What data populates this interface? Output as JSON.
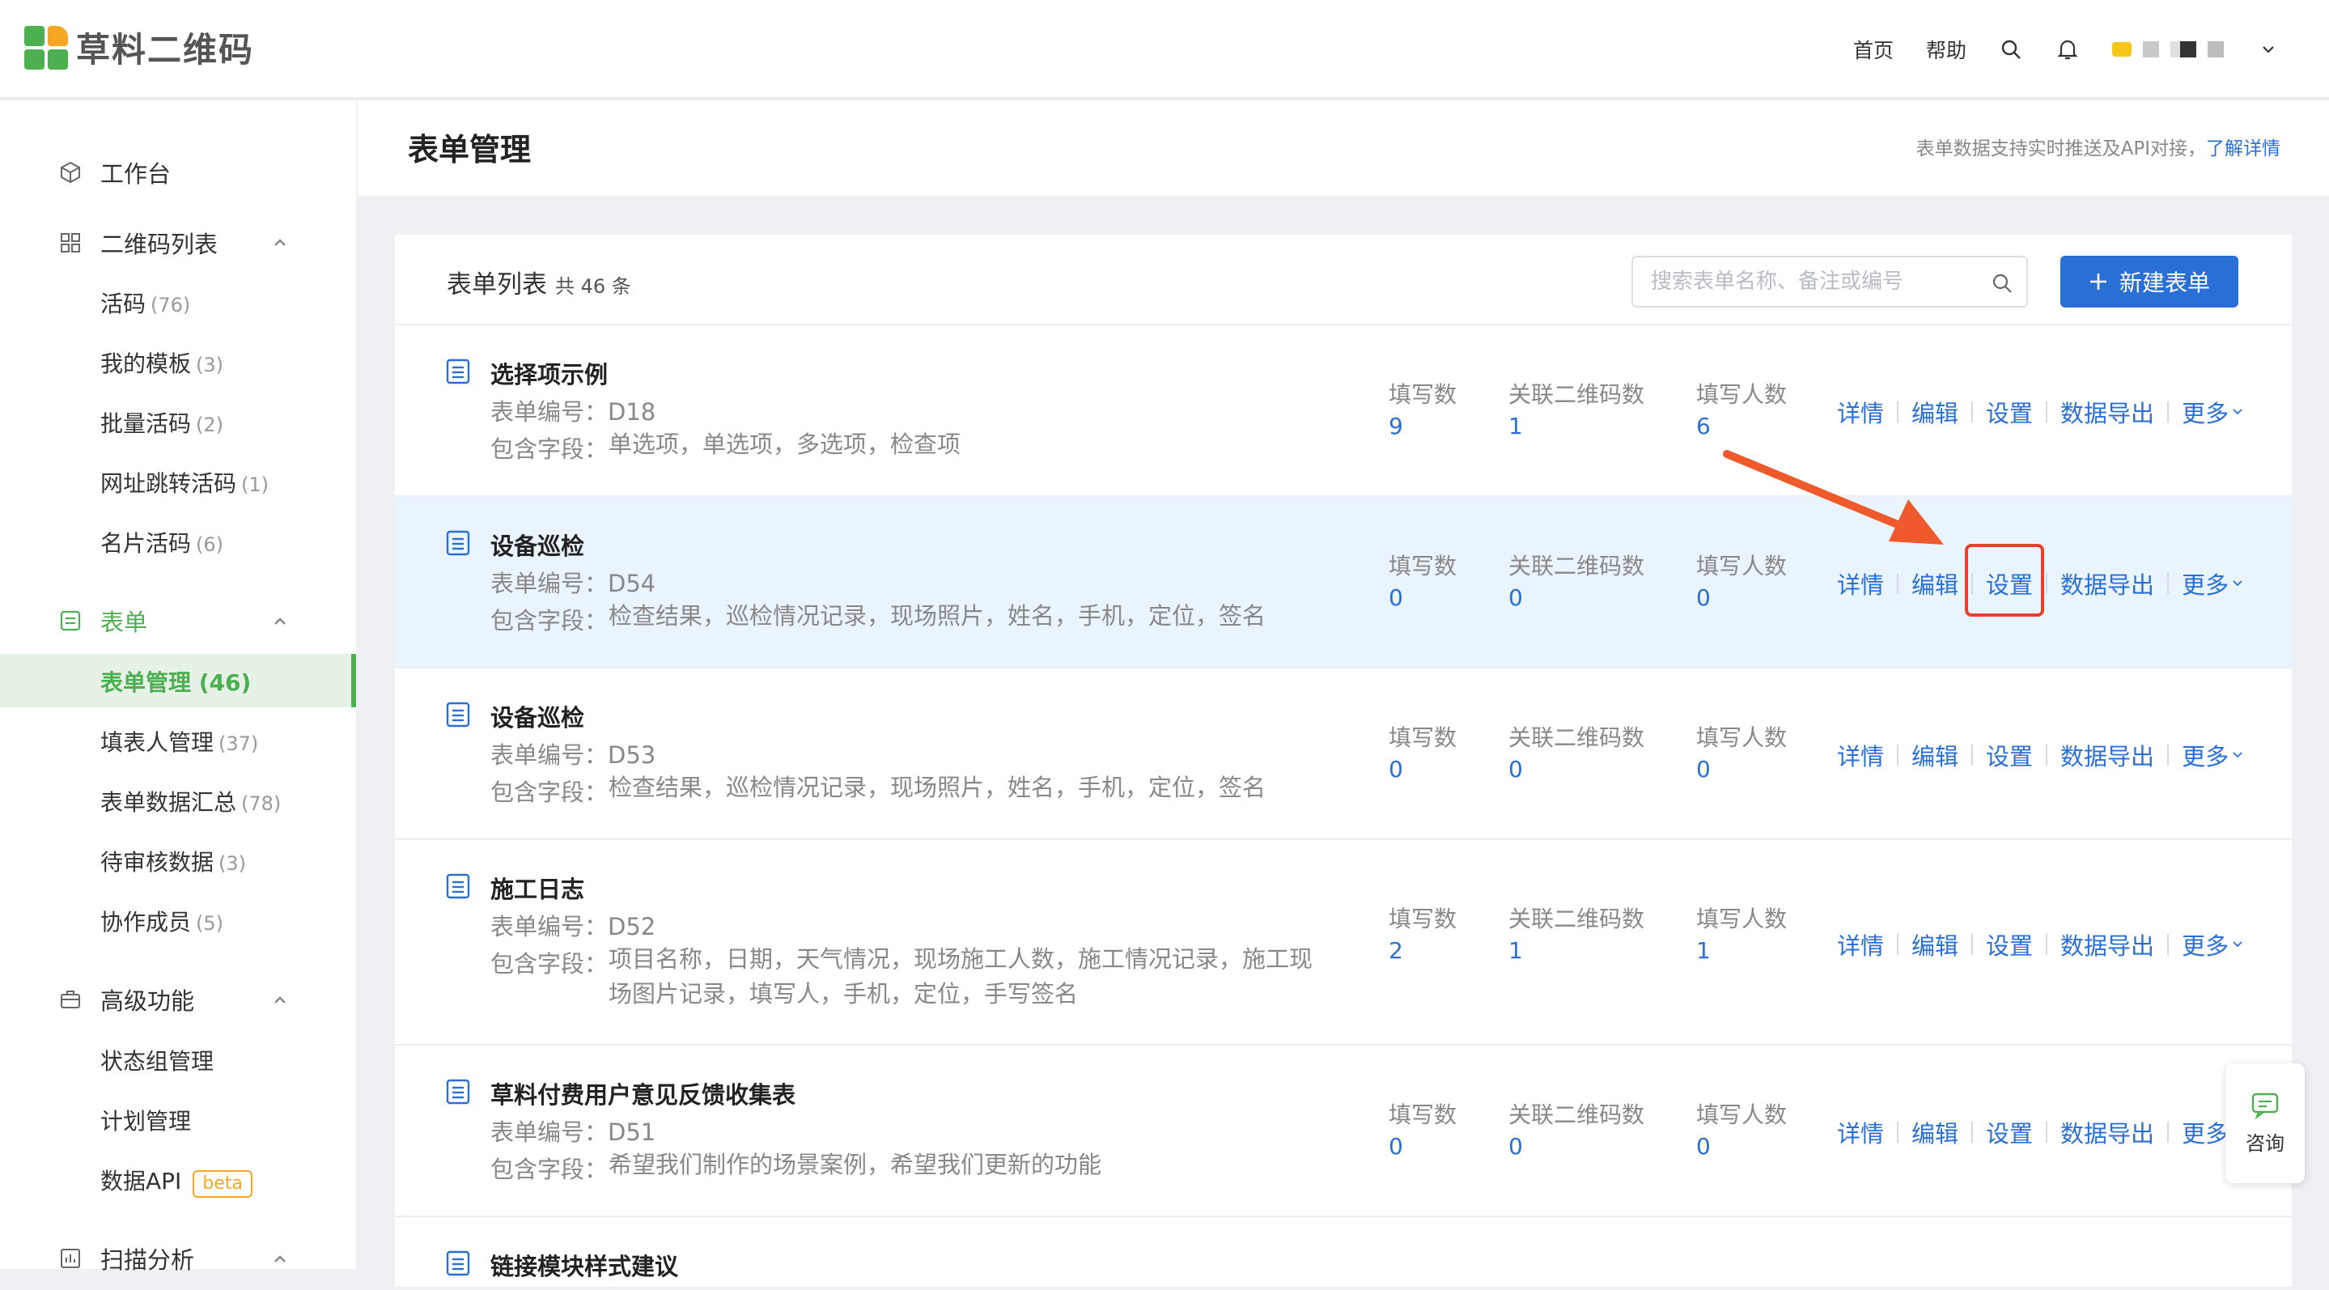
{
  "header": {
    "logo_text": "草料二维码",
    "nav": {
      "home": "首页",
      "help": "帮助"
    }
  },
  "sidebar": {
    "workbench": "工作台",
    "qr_group": {
      "label": "二维码列表",
      "items": [
        {
          "label": "活码",
          "count": "(76)"
        },
        {
          "label": "我的模板",
          "count": "(3)"
        },
        {
          "label": "批量活码",
          "count": "(2)"
        },
        {
          "label": "网址跳转活码",
          "count": "(1)"
        },
        {
          "label": "名片活码",
          "count": "(6)"
        }
      ]
    },
    "form_group": {
      "label": "表单",
      "items": [
        {
          "label": "表单管理 (46)",
          "count": ""
        },
        {
          "label": "填表人管理",
          "count": "(37)"
        },
        {
          "label": "表单数据汇总",
          "count": "(78)"
        },
        {
          "label": "待审核数据",
          "count": "(3)"
        },
        {
          "label": "协作成员",
          "count": "(5)"
        }
      ]
    },
    "adv_group": {
      "label": "高级功能",
      "items": [
        {
          "label": "状态组管理"
        },
        {
          "label": "计划管理"
        },
        {
          "label": "数据API",
          "badge": "beta"
        }
      ]
    },
    "scan_group": {
      "label": "扫描分析"
    }
  },
  "page": {
    "title": "表单管理",
    "note": "表单数据支持实时推送及API对接，",
    "note_link": "了解详情"
  },
  "list": {
    "title": "表单列表",
    "total": "共 46 条",
    "search_placeholder": "搜索表单名称、备注或编号",
    "new_button": "新建表单",
    "labels": {
      "code": "表单编号：",
      "fields": "包含字段：",
      "fill_count": "填写数",
      "qr_count": "关联二维码数",
      "user_count": "填写人数"
    },
    "actions": {
      "detail": "详情",
      "edit": "编辑",
      "settings": "设置",
      "export": "数据导出",
      "more": "更多"
    },
    "rows": [
      {
        "name": "选择项示例",
        "code": "D18",
        "fields": "单选项，单选项，多选项，检查项",
        "fill": "9",
        "qr": "1",
        "users": "6"
      },
      {
        "name": "设备巡检",
        "code": "D54",
        "fields": "检查结果，巡检情况记录，现场照片，姓名，手机，定位，签名",
        "fill": "0",
        "qr": "0",
        "users": "0"
      },
      {
        "name": "设备巡检",
        "code": "D53",
        "fields": "检查结果，巡检情况记录，现场照片，姓名，手机，定位，签名",
        "fill": "0",
        "qr": "0",
        "users": "0"
      },
      {
        "name": "施工日志",
        "code": "D52",
        "fields": "项目名称，日期，天气情况，现场施工人数，施工情况记录，施工现场图片记录，填写人，手机，定位，手写签名",
        "fill": "2",
        "qr": "1",
        "users": "1"
      },
      {
        "name": "草料付费用户意见反馈收集表",
        "code": "D51",
        "fields": "希望我们制作的场景案例，希望我们更新的功能",
        "fill": "0",
        "qr": "0",
        "users": "0"
      },
      {
        "name": "链接模块样式建议",
        "code": "",
        "fields": "",
        "fill": "",
        "qr": "",
        "users": ""
      }
    ]
  },
  "consult": {
    "label": "咨询"
  },
  "colors": {
    "brand_green": "#4caf50",
    "link_blue": "#2a6fd6",
    "highlight_red": "#e8402a",
    "arrow": "#ee5a2b"
  }
}
